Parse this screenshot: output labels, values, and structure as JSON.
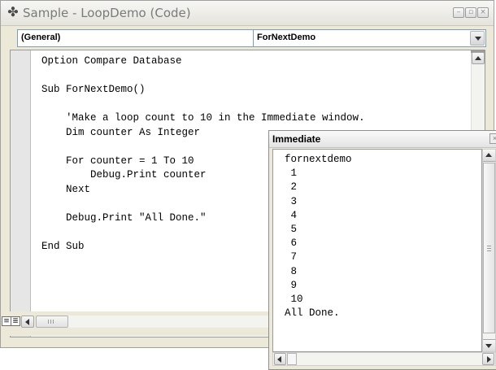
{
  "code_window": {
    "title": "Sample - LoopDemo (Code)",
    "icon": "vba-code-icon",
    "caption_buttons": {
      "minimize_glyph": "–",
      "restore_glyph": "▫",
      "close_glyph": "×"
    },
    "object_dropdown": {
      "selected": "(General)"
    },
    "procedure_dropdown": {
      "selected": "ForNextDemo"
    },
    "code_lines": [
      "Option Compare Database",
      "",
      "Sub ForNextDemo()",
      "",
      "    'Make a loop count to 10 in the Immediate window.",
      "    Dim counter As Integer",
      "",
      "    For counter = 1 To 10",
      "        Debug.Print counter",
      "    Next",
      "",
      "    Debug.Print \"All Done.\"",
      "",
      "End Sub"
    ],
    "view_buttons": {
      "procedure_view_glyph": "≡",
      "full_module_view_glyph": "≣"
    }
  },
  "immediate_window": {
    "title": "Immediate",
    "output_lines": [
      "fornextdemo",
      " 1",
      " 2",
      " 3",
      " 4",
      " 5",
      " 6",
      " 7",
      " 8",
      " 9",
      " 10",
      "All Done."
    ]
  },
  "colors": {
    "window_face": "#ece9d8",
    "code_background": "#ffffff",
    "title_text": "#7a7a7a"
  }
}
